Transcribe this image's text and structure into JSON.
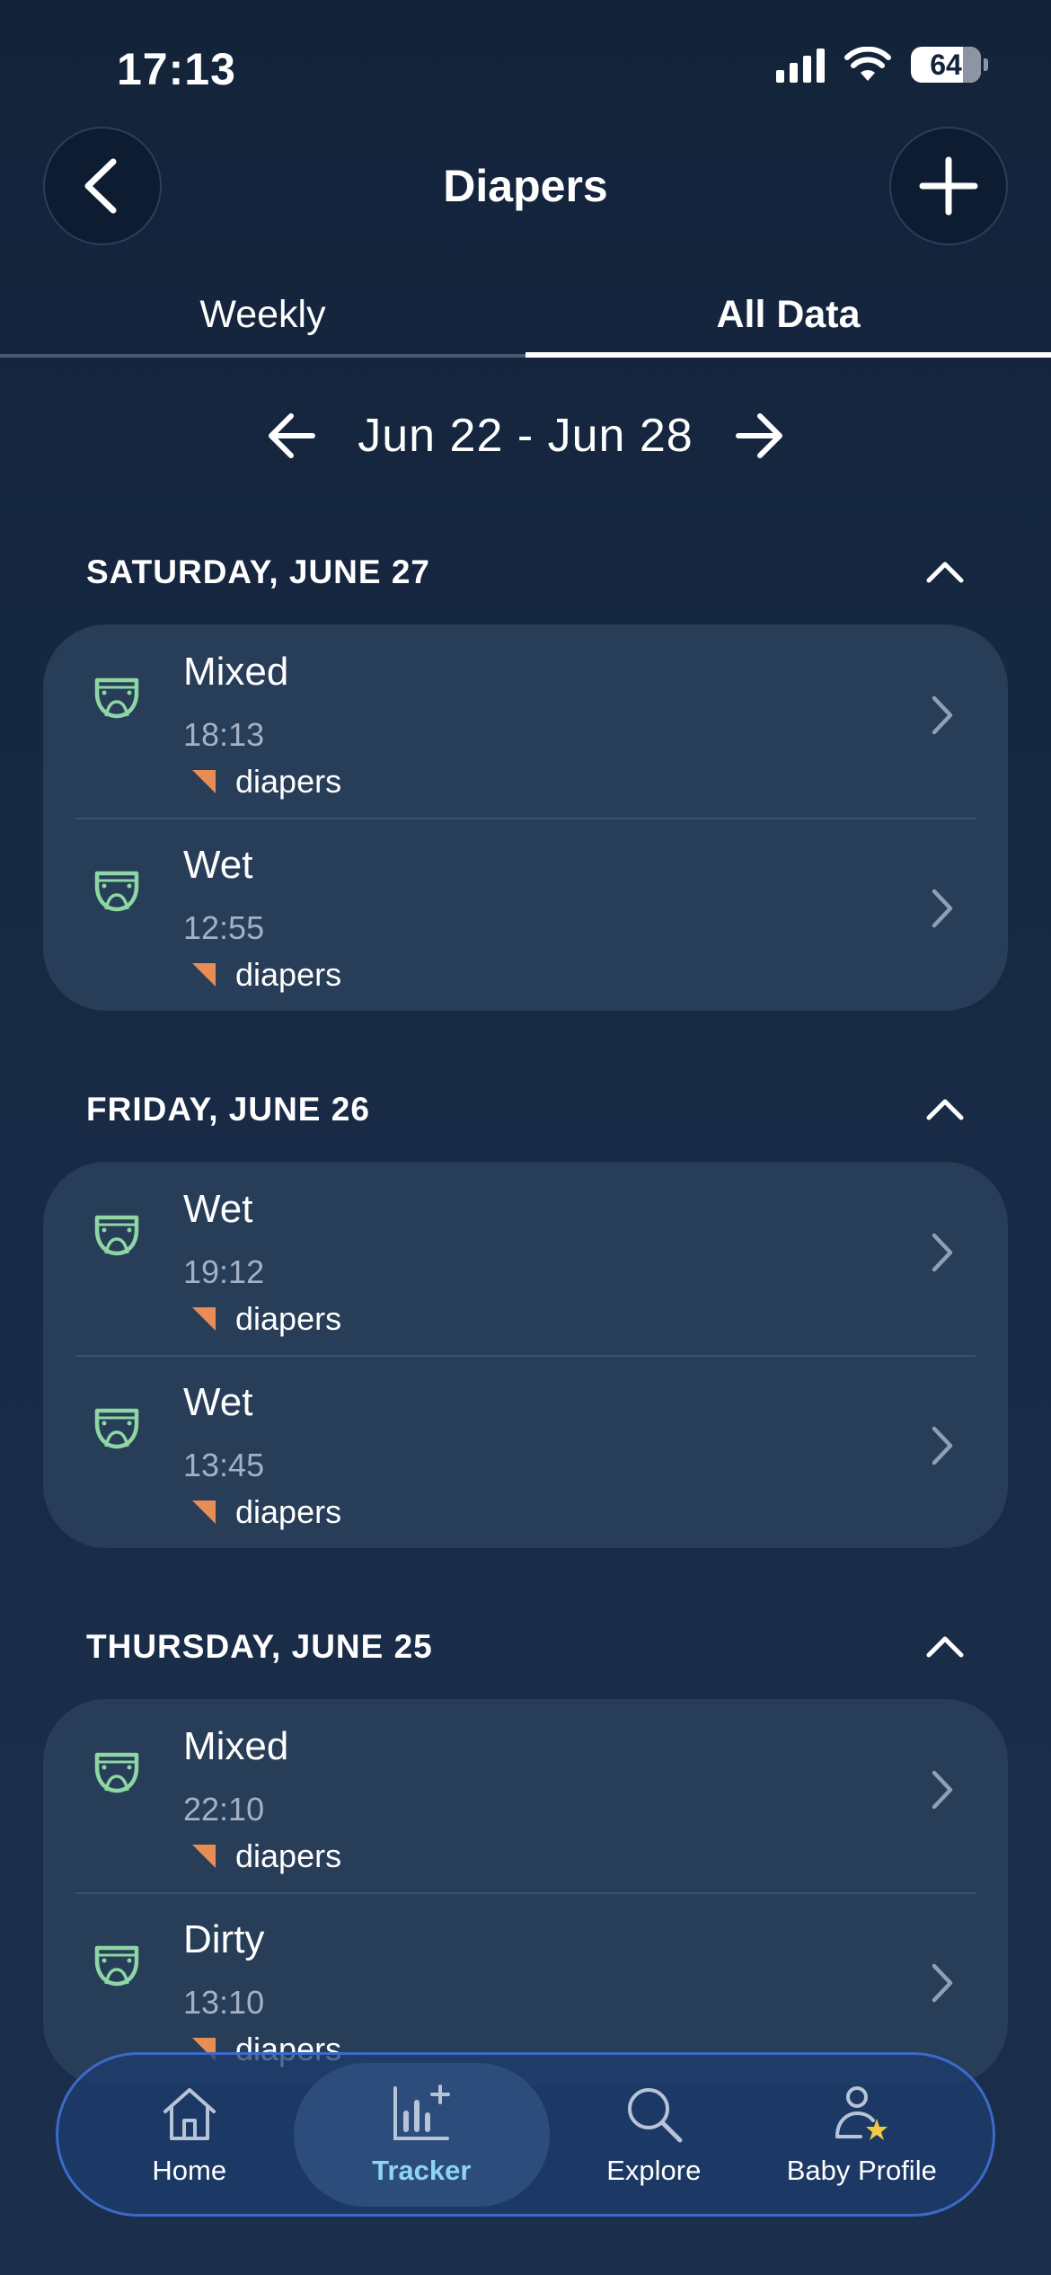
{
  "status_bar": {
    "time": "17:13",
    "battery": "64"
  },
  "header": {
    "title": "Diapers"
  },
  "tabs": [
    {
      "label": "Weekly",
      "active": false
    },
    {
      "label": "All Data",
      "active": true
    }
  ],
  "week_nav": {
    "range": "Jun 22 - Jun 28"
  },
  "days": [
    {
      "title": "SATURDAY, JUNE 27",
      "entries": [
        {
          "type": "Mixed",
          "time": "18:13",
          "tag": "diapers"
        },
        {
          "type": "Wet",
          "time": "12:55",
          "tag": "diapers"
        }
      ]
    },
    {
      "title": "FRIDAY, JUNE 26",
      "entries": [
        {
          "type": "Wet",
          "time": "19:12",
          "tag": "diapers"
        },
        {
          "type": "Wet",
          "time": "13:45",
          "tag": "diapers"
        }
      ]
    },
    {
      "title": "THURSDAY, JUNE 25",
      "entries": [
        {
          "type": "Mixed",
          "time": "22:10",
          "tag": "diapers"
        },
        {
          "type": "Dirty",
          "time": "13:10",
          "tag": "diapers"
        }
      ]
    }
  ],
  "bottom_nav": [
    {
      "label": "Home",
      "icon": "home-icon",
      "active": false
    },
    {
      "label": "Tracker",
      "icon": "tracker-icon",
      "active": true
    },
    {
      "label": "Explore",
      "icon": "search-icon",
      "active": false
    },
    {
      "label": "Baby Profile",
      "icon": "baby-profile-icon",
      "active": false
    }
  ],
  "colors": {
    "accent_green": "#8ed7a4",
    "tag_orange": "#e98d57",
    "active_nav": "#8fd3f2"
  }
}
